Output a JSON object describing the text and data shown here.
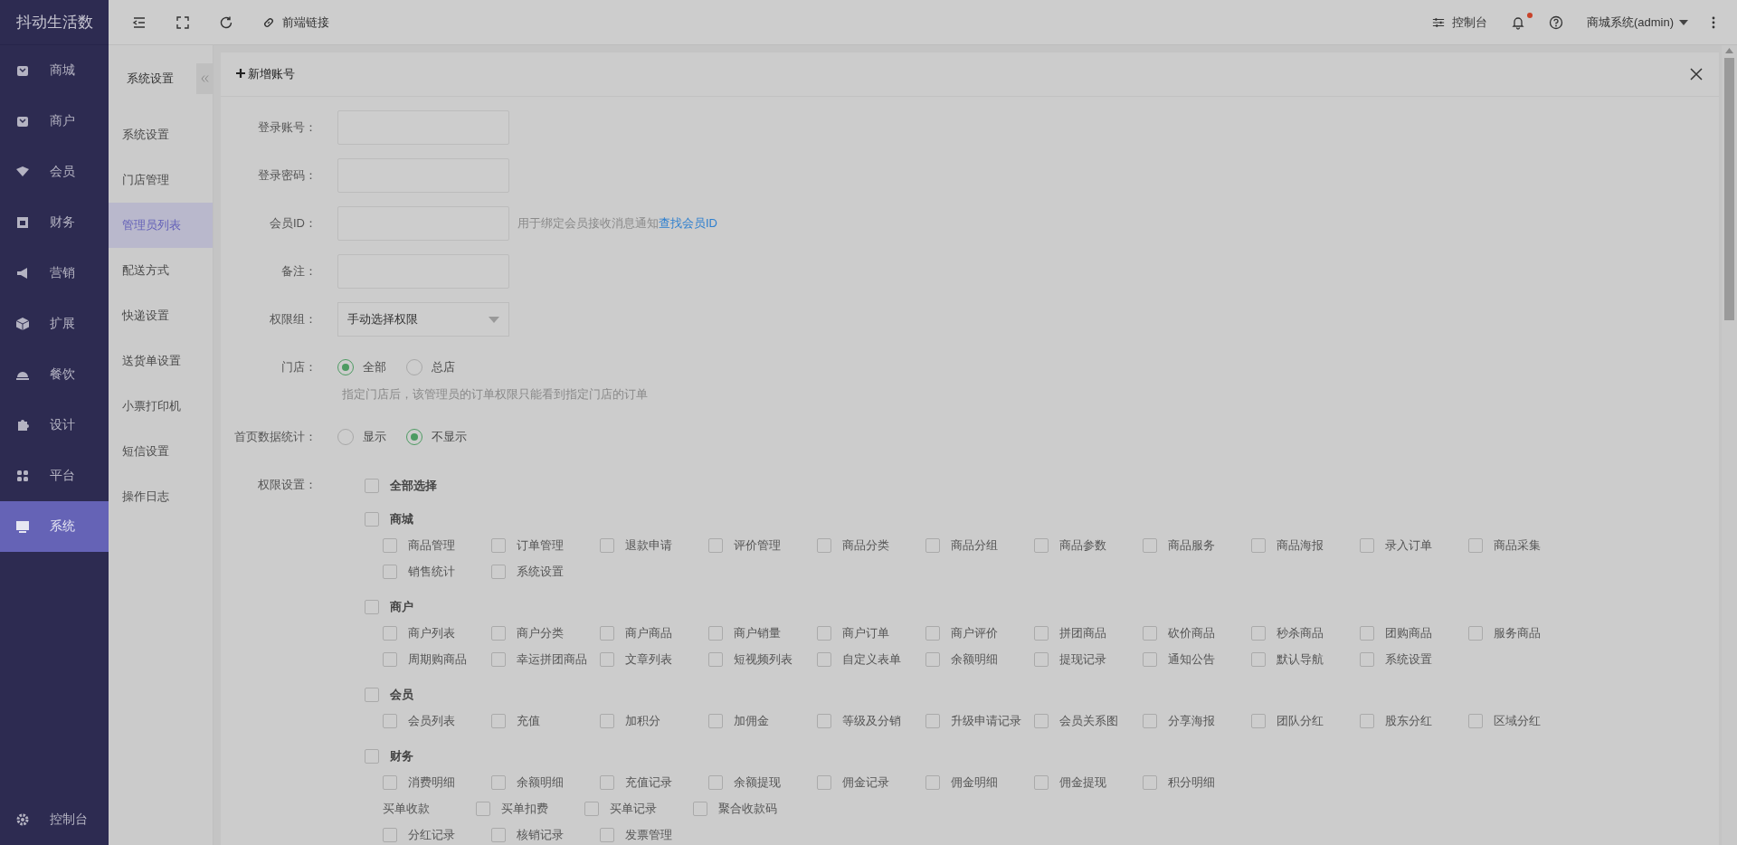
{
  "sidebar": {
    "logo": "抖动生活数",
    "items": [
      {
        "label": "商城",
        "selected": false
      },
      {
        "label": "商户",
        "selected": false
      },
      {
        "label": "会员",
        "selected": false
      },
      {
        "label": "财务",
        "selected": false
      },
      {
        "label": "营销",
        "selected": false
      },
      {
        "label": "扩展",
        "selected": false
      },
      {
        "label": "餐饮",
        "selected": false
      },
      {
        "label": "设计",
        "selected": false
      },
      {
        "label": "平台",
        "selected": false
      },
      {
        "label": "系统",
        "selected": true
      }
    ],
    "footer": "控制台"
  },
  "top_bar": {
    "link": "前端链接",
    "console": "控制台",
    "notification_dot": true,
    "user": "商城系统(admin)"
  },
  "sub_sidebar": {
    "title": "系统设置",
    "items": [
      {
        "label": "系统设置",
        "selected": false
      },
      {
        "label": "门店管理",
        "selected": false
      },
      {
        "label": "管理员列表",
        "selected": true
      },
      {
        "label": "配送方式",
        "selected": false
      },
      {
        "label": "快递设置",
        "selected": false
      },
      {
        "label": "送货单设置",
        "selected": false
      },
      {
        "label": "小票打印机",
        "selected": false
      },
      {
        "label": "短信设置",
        "selected": false
      },
      {
        "label": "操作日志",
        "selected": false
      }
    ]
  },
  "dialog": {
    "title": "新增账号",
    "fields": [
      {
        "kind": "input",
        "label": "登录账号："
      },
      {
        "kind": "input",
        "label": "登录密码："
      },
      {
        "kind": "input",
        "label": "会员ID：",
        "help": "用于绑定会员接收消息通知",
        "link": "查找会员ID"
      },
      {
        "kind": "input",
        "label": "备注："
      },
      {
        "kind": "select",
        "label": "权限组：",
        "value": "手动选择权限"
      },
      {
        "kind": "radio",
        "label": "门店：",
        "options": [
          {
            "label": "全部",
            "selected": true
          },
          {
            "label": "总店",
            "selected": false
          }
        ],
        "hint": "指定门店后，该管理员的订单权限只能看到指定门店的订单"
      },
      {
        "kind": "radio",
        "label": "首页数据统计：",
        "options": [
          {
            "label": "显示",
            "selected": false
          },
          {
            "label": "不显示",
            "selected": true
          }
        ]
      }
    ],
    "permissions": {
      "label": "权限设置：",
      "select_all": {
        "label": "全部选择",
        "checked": false
      },
      "groups": [
        {
          "title": "商城",
          "checked": false,
          "rows": [
            [
              {
                "kind": "checkbox",
                "label": "商品管理",
                "checked": false
              },
              {
                "kind": "checkbox",
                "label": "订单管理",
                "checked": false
              },
              {
                "kind": "checkbox",
                "label": "退款申请",
                "checked": false
              },
              {
                "kind": "checkbox",
                "label": "评价管理",
                "checked": false
              },
              {
                "kind": "checkbox",
                "label": "商品分类",
                "checked": false
              },
              {
                "kind": "checkbox",
                "label": "商品分组",
                "checked": false
              },
              {
                "kind": "checkbox",
                "label": "商品参数",
                "checked": false
              },
              {
                "kind": "checkbox",
                "label": "商品服务",
                "checked": false
              },
              {
                "kind": "checkbox",
                "label": "商品海报",
                "checked": false
              },
              {
                "kind": "checkbox",
                "label": "录入订单",
                "checked": false
              },
              {
                "kind": "checkbox",
                "label": "商品采集",
                "checked": false
              }
            ],
            [
              {
                "kind": "checkbox",
                "label": "销售统计",
                "checked": false
              },
              {
                "kind": "checkbox",
                "label": "系统设置",
                "checked": false
              }
            ]
          ]
        },
        {
          "title": "商户",
          "checked": false,
          "rows": [
            [
              {
                "kind": "checkbox",
                "label": "商户列表",
                "checked": false
              },
              {
                "kind": "checkbox",
                "label": "商户分类",
                "checked": false
              },
              {
                "kind": "checkbox",
                "label": "商户商品",
                "checked": false
              },
              {
                "kind": "checkbox",
                "label": "商户销量",
                "checked": false
              },
              {
                "kind": "checkbox",
                "label": "商户订单",
                "checked": false
              },
              {
                "kind": "checkbox",
                "label": "商户评价",
                "checked": false
              },
              {
                "kind": "checkbox",
                "label": "拼团商品",
                "checked": false
              },
              {
                "kind": "checkbox",
                "label": "砍价商品",
                "checked": false
              },
              {
                "kind": "checkbox",
                "label": "秒杀商品",
                "checked": false
              },
              {
                "kind": "checkbox",
                "label": "团购商品",
                "checked": false
              },
              {
                "kind": "checkbox",
                "label": "服务商品",
                "checked": false
              }
            ],
            [
              {
                "kind": "checkbox",
                "label": "周期购商品",
                "checked": false
              },
              {
                "kind": "checkbox",
                "label": "幸运拼团商品",
                "checked": false
              },
              {
                "kind": "checkbox",
                "label": "文章列表",
                "checked": false
              },
              {
                "kind": "checkbox",
                "label": "短视频列表",
                "checked": false
              },
              {
                "kind": "checkbox",
                "label": "自定义表单",
                "checked": false
              },
              {
                "kind": "checkbox",
                "label": "余额明细",
                "checked": false
              },
              {
                "kind": "checkbox",
                "label": "提现记录",
                "checked": false
              },
              {
                "kind": "checkbox",
                "label": "通知公告",
                "checked": false
              },
              {
                "kind": "checkbox",
                "label": "默认导航",
                "checked": false
              },
              {
                "kind": "checkbox",
                "label": "系统设置",
                "checked": false
              }
            ]
          ]
        },
        {
          "title": "会员",
          "checked": false,
          "rows": [
            [
              {
                "kind": "checkbox",
                "label": "会员列表",
                "checked": false
              },
              {
                "kind": "checkbox",
                "label": "充值",
                "checked": false
              },
              {
                "kind": "checkbox",
                "label": "加积分",
                "checked": false
              },
              {
                "kind": "checkbox",
                "label": "加佣金",
                "checked": false
              },
              {
                "kind": "checkbox",
                "label": "等级及分销",
                "checked": false
              },
              {
                "kind": "checkbox",
                "label": "升级申请记录",
                "checked": false
              },
              {
                "kind": "checkbox",
                "label": "会员关系图",
                "checked": false
              },
              {
                "kind": "checkbox",
                "label": "分享海报",
                "checked": false
              },
              {
                "kind": "checkbox",
                "label": "团队分红",
                "checked": false
              },
              {
                "kind": "checkbox",
                "label": "股东分红",
                "checked": false
              },
              {
                "kind": "checkbox",
                "label": "区域分红",
                "checked": false
              }
            ]
          ]
        },
        {
          "title": "财务",
          "checked": false,
          "rows": [
            [
              {
                "kind": "checkbox",
                "label": "消费明细",
                "checked": false
              },
              {
                "kind": "checkbox",
                "label": "余额明细",
                "checked": false
              },
              {
                "kind": "checkbox",
                "label": "充值记录",
                "checked": false
              },
              {
                "kind": "checkbox",
                "label": "余额提现",
                "checked": false
              },
              {
                "kind": "checkbox",
                "label": "佣金记录",
                "checked": false
              },
              {
                "kind": "checkbox",
                "label": "佣金明细",
                "checked": false
              },
              {
                "kind": "checkbox",
                "label": "佣金提现",
                "checked": false
              },
              {
                "kind": "checkbox",
                "label": "积分明细",
                "checked": false
              }
            ],
            [
              {
                "kind": "label",
                "label": "买单收款"
              },
              {
                "kind": "checkbox",
                "label": "买单扣费",
                "checked": false
              },
              {
                "kind": "checkbox",
                "label": "买单记录",
                "checked": false
              },
              {
                "kind": "checkbox",
                "label": "聚合收款码",
                "checked": false
              }
            ],
            [
              {
                "kind": "checkbox",
                "label": "分红记录",
                "checked": false
              },
              {
                "kind": "checkbox",
                "label": "核销记录",
                "checked": false
              },
              {
                "kind": "checkbox",
                "label": "发票管理",
                "checked": false
              }
            ]
          ]
        }
      ]
    }
  }
}
